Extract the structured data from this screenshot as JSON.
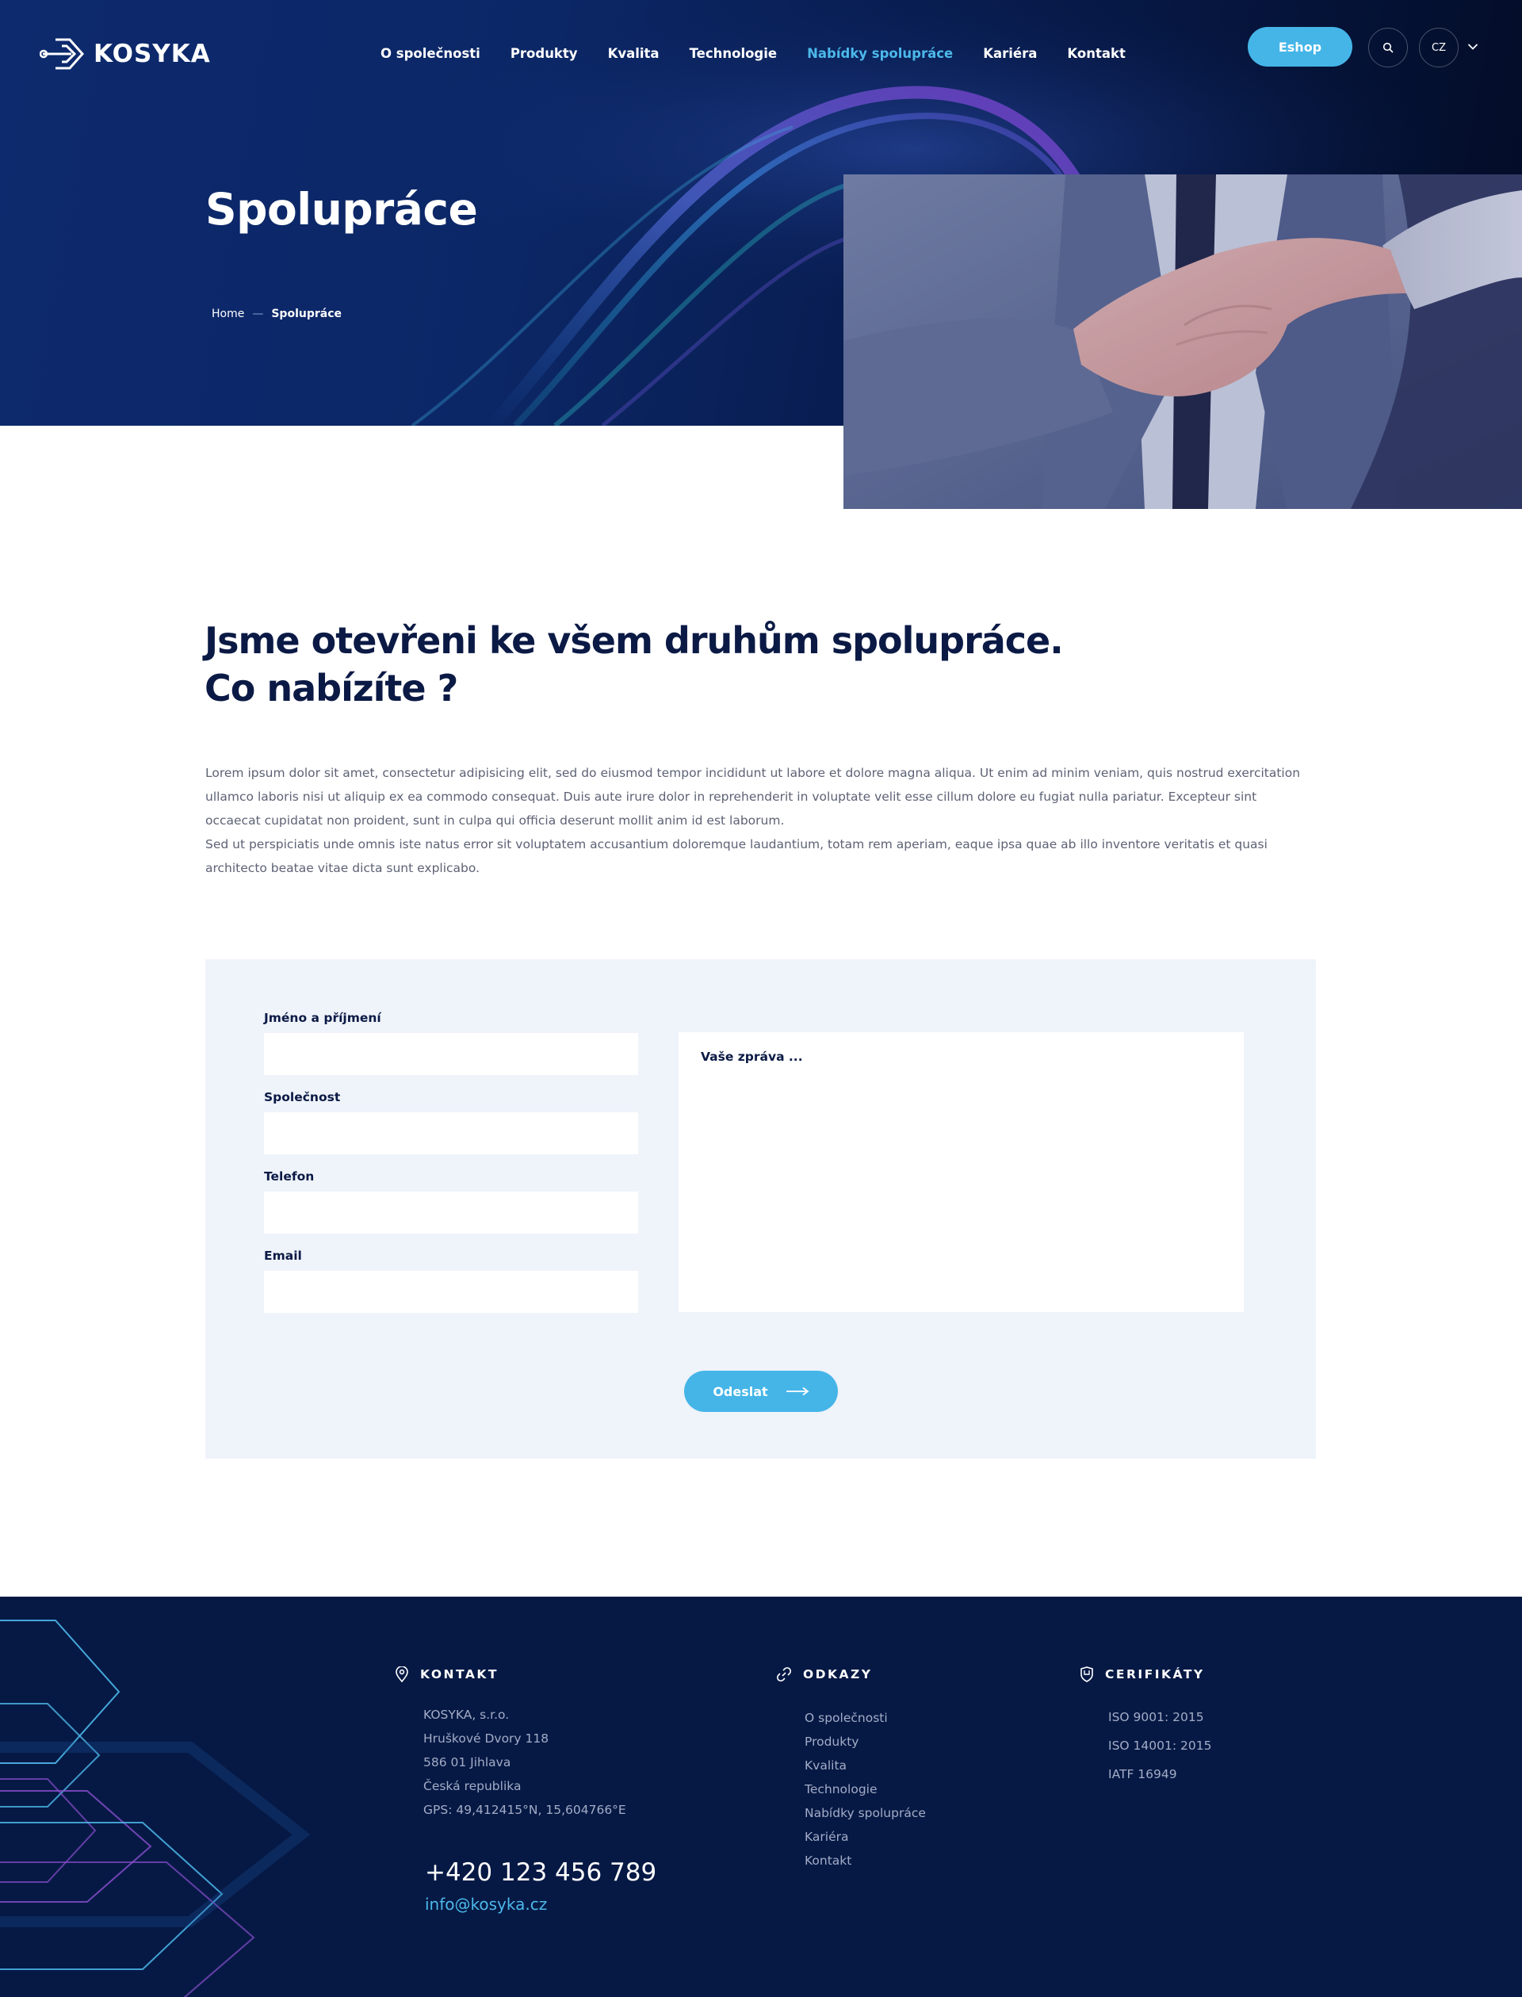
{
  "brand": {
    "logo_text": "KOSYKA"
  },
  "nav": {
    "items": [
      {
        "label": "O společnosti"
      },
      {
        "label": "Produkty"
      },
      {
        "label": "Kvalita"
      },
      {
        "label": "Technologie"
      },
      {
        "label": "Nabídky spolupráce",
        "active": true
      },
      {
        "label": "Kariéra"
      },
      {
        "label": "Kontakt"
      }
    ],
    "eshop_label": "Eshop",
    "search_icon": "search-icon",
    "language": "CZ",
    "chevron_icon": "chevron-down-icon"
  },
  "hero": {
    "title": "Spolupráce",
    "breadcrumb": {
      "home": "Home",
      "separator": "—",
      "current": "Spolupráce"
    },
    "photo_icon": "handshake-photo"
  },
  "intro": {
    "title_line1": "Jsme otevřeni ke všem druhům spolupráce.",
    "title_line2": "Co nabízíte ?",
    "paragraph_1": "Lorem ipsum dolor sit amet, consectetur adipisicing elit, sed do eiusmod tempor incididunt ut labore et dolore magna aliqua. Ut enim ad minim veniam, quis nostrud exercitation ullamco laboris nisi ut aliquip ex ea commodo consequat. Duis aute irure dolor in reprehenderit in voluptate velit esse cillum dolore eu fugiat nulla pariatur. Excepteur sint occaecat cupidatat non proident, sunt in culpa qui officia deserunt mollit anim id est laborum.",
    "paragraph_2": "Sed ut perspiciatis unde omnis iste natus error sit voluptatem accusantium doloremque laudantium, totam rem aperiam, eaque ipsa quae ab illo inventore veritatis et quasi architecto beatae vitae dicta sunt explicabo."
  },
  "form": {
    "name_label": "Jméno a příjmení",
    "name_value": "",
    "company_label": "Společnost",
    "company_value": "",
    "phone_label": "Telefon",
    "phone_value": "",
    "email_label": "Email",
    "email_value": "",
    "message_placeholder": "Vaše zpráva ...",
    "submit_label": "Odeslat",
    "submit_icon": "arrow-right-icon"
  },
  "footer": {
    "contact": {
      "heading": "KONTAKT",
      "icon": "location-pin-icon",
      "lines": [
        "KOSYKA, s.r.o.",
        "Hruškové Dvory 118",
        "586 01 Jihlava",
        "Česká republika",
        "GPS: 49,412415°N, 15,604766°E"
      ],
      "phone": "+420 123 456 789",
      "email": "info@kosyka.cz"
    },
    "links": {
      "heading": "ODKAZY",
      "icon": "link-icon",
      "items": [
        "O společnosti",
        "Produkty",
        "Kvalita",
        "Technologie",
        "Nabídky spolupráce",
        "Kariéra",
        "Kontakt"
      ]
    },
    "certs": {
      "heading": "CERIFIKÁTY",
      "icon": "shield-icon",
      "items": [
        "ISO 9001: 2015",
        "ISO 14001: 2015",
        "IATF 16949"
      ]
    }
  },
  "colors": {
    "accent": "#45b5e8",
    "navy": "#0b1a45",
    "footer_bg": "#061945",
    "form_bg": "#eff3fa"
  }
}
